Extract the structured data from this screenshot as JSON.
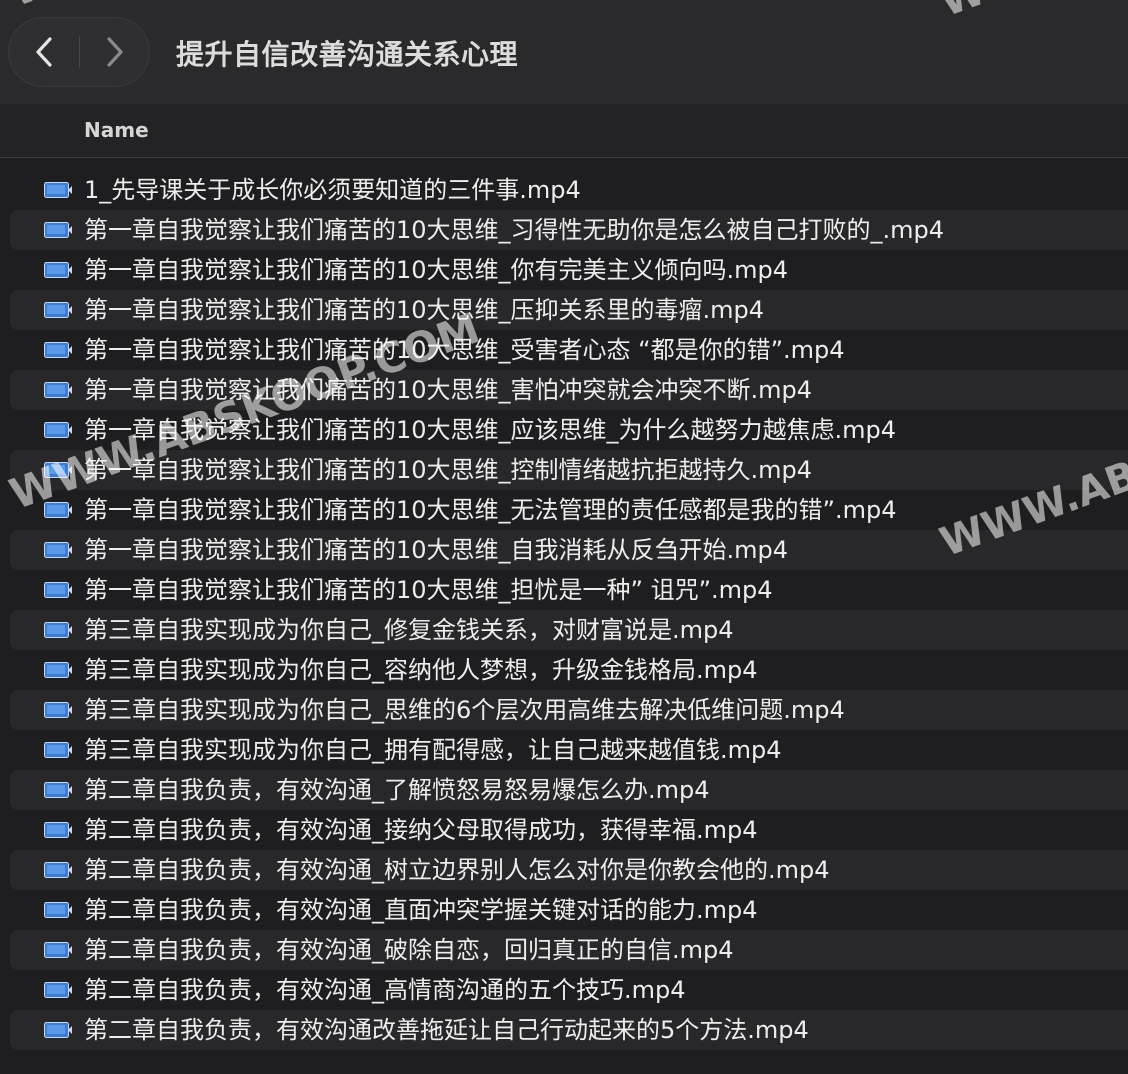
{
  "window": {
    "title": "提升自信改善沟通关系心理"
  },
  "nav": {
    "back_icon": "chevron-left-icon",
    "forward_icon": "chevron-right-icon"
  },
  "columns": {
    "name": "Name"
  },
  "files": [
    {
      "name": "1_先导课关于成长你必须要知道的三件事.mp4"
    },
    {
      "name": "第一章自我觉察让我们痛苦的10大思维_习得性无助你是怎么被自己打败的_.mp4"
    },
    {
      "name": "第一章自我觉察让我们痛苦的10大思维_你有完美主义倾向吗.mp4"
    },
    {
      "name": "第一章自我觉察让我们痛苦的10大思维_压抑关系里的毒瘤.mp4"
    },
    {
      "name": "第一章自我觉察让我们痛苦的10大思维_受害者心态 “都是你的错”.mp4"
    },
    {
      "name": "第一章自我觉察让我们痛苦的10大思维_害怕冲突就会冲突不断.mp4"
    },
    {
      "name": "第一章自我觉察让我们痛苦的10大思维_应该思维_为什么越努力越焦虑.mp4"
    },
    {
      "name": "第一章自我觉察让我们痛苦的10大思维_控制情绪越抗拒越持久.mp4"
    },
    {
      "name": "第一章自我觉察让我们痛苦的10大思维_无法管理的责任感都是我的错”.mp4"
    },
    {
      "name": "第一章自我觉察让我们痛苦的10大思维_自我消耗从反刍开始.mp4"
    },
    {
      "name": "第一章自我觉察让我们痛苦的10大思维_担忧是一种” 诅咒”.mp4"
    },
    {
      "name": "第三章自我实现成为你自己_修复金钱关系，对财富说是.mp4"
    },
    {
      "name": "第三章自我实现成为你自己_容纳他人梦想，升级金钱格局.mp4"
    },
    {
      "name": "第三章自我实现成为你自己_思维的6个层次用高维去解决低维问题.mp4"
    },
    {
      "name": "第三章自我实现成为你自己_拥有配得感，让自己越来越值钱.mp4"
    },
    {
      "name": "第二章自我负责，有效沟通_了解愤怒易怒易爆怎么办.mp4"
    },
    {
      "name": "第二章自我负责，有效沟通_接纳父母取得成功，获得幸福.mp4"
    },
    {
      "name": "第二章自我负责，有效沟通_树立边界别人怎么对你是你教会他的.mp4"
    },
    {
      "name": "第二章自我负责，有效沟通_直面冲突学握关键对话的能力.mp4"
    },
    {
      "name": "第二章自我负责，有效沟通_破除自恋，回归真正的自信.mp4"
    },
    {
      "name": "第二章自我负责，有效沟通_高情商沟通的五个技巧.mp4"
    },
    {
      "name": "第二章自我负责，有效沟通改善拖延让自己行动起来的5个方法.mp4"
    }
  ],
  "file_icon": "video-file-icon",
  "watermarks": [
    "WWW.ABSKOOP.COM",
    "WWW.AB",
    "WWW.",
    "WWW."
  ],
  "colors": {
    "background": "#1e1e21",
    "toolbar": "#2a2a2c",
    "row_alt": "#28282b",
    "icon_blue": "#3b7dd8"
  }
}
